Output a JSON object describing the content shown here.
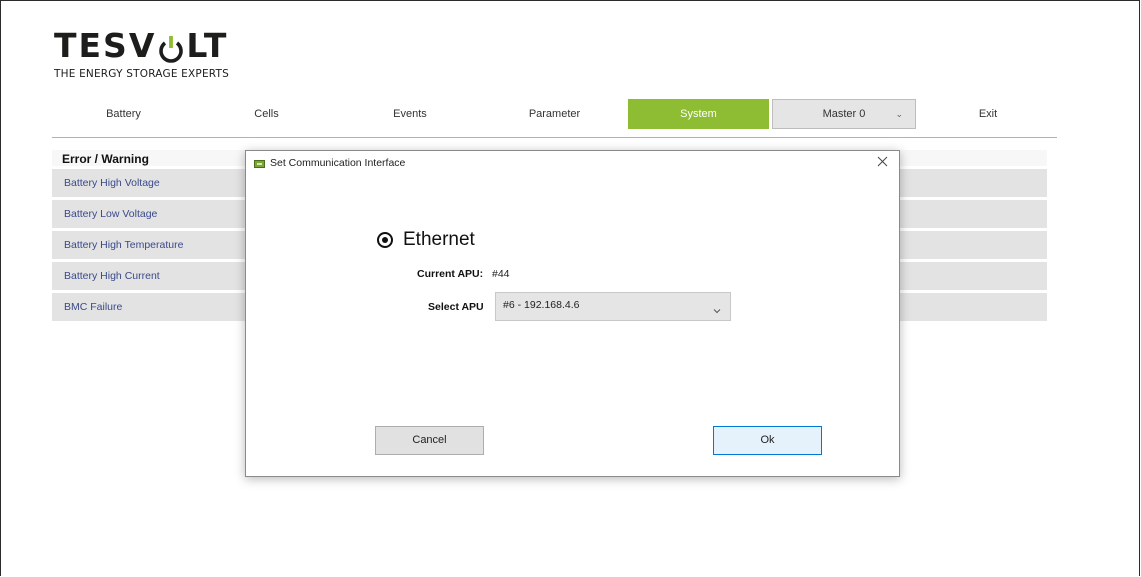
{
  "logo": {
    "word_part1": "TESV",
    "word_part2": "LT",
    "tagline": "THE ENERGY STORAGE EXPERTS"
  },
  "nav": {
    "battery": "Battery",
    "cells": "Cells",
    "events": "Events",
    "parameter": "Parameter",
    "system": "System",
    "master_select": "Master 0",
    "exit": "Exit",
    "active": "System",
    "active_color": "#8ebd34"
  },
  "errors": {
    "title": "Error / Warning",
    "rows": [
      "Battery High Voltage",
      "Battery Low Voltage",
      "Battery High Temperature",
      "Battery High Current",
      "BMC Failure"
    ]
  },
  "dialog": {
    "title": "Set Communication Interface",
    "radio_label": "Ethernet",
    "radio_selected": true,
    "current_apu_label": "Current APU:",
    "current_apu_value": "#44",
    "select_apu_label": "Select APU",
    "select_apu_value": "#6 - 192.168.4.6",
    "cancel_label": "Cancel",
    "ok_label": "Ok",
    "close_icon": "close-icon"
  }
}
